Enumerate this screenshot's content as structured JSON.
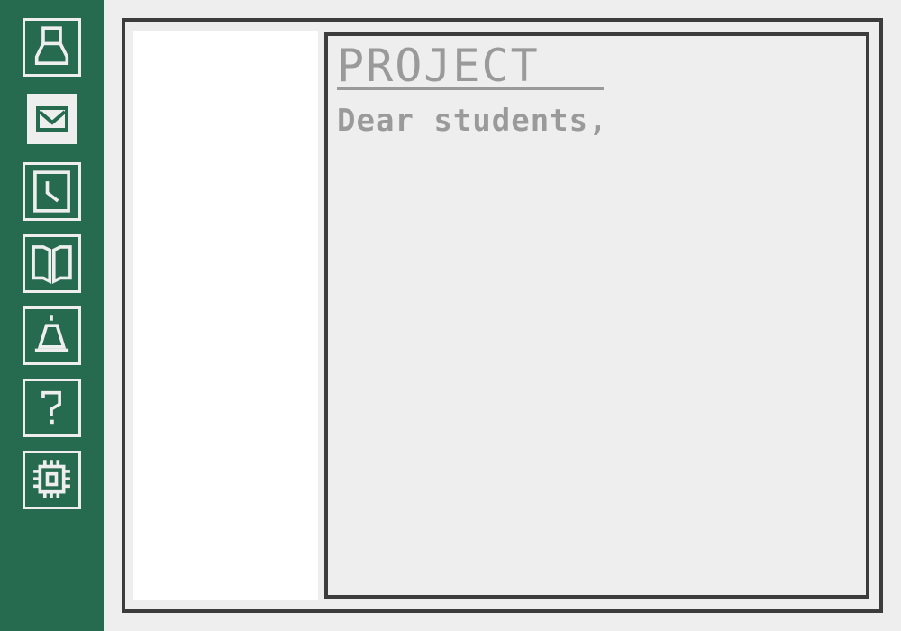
{
  "sidebar": {
    "icons": [
      {
        "name": "user-icon"
      },
      {
        "name": "mail-icon",
        "active": true
      },
      {
        "name": "clock-icon"
      },
      {
        "name": "book-icon"
      },
      {
        "name": "bell-icon"
      },
      {
        "name": "help-icon"
      },
      {
        "name": "chip-icon"
      }
    ]
  },
  "document": {
    "title": "PROJECT",
    "body": "Dear students,"
  },
  "colors": {
    "sidebar": "#266b50",
    "background": "#eeeeee",
    "border": "#3c3c3c",
    "text": "#9a9a9a"
  }
}
